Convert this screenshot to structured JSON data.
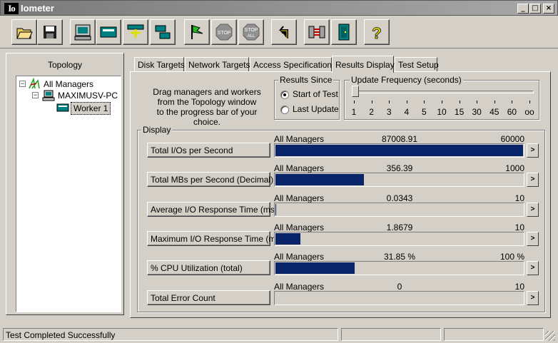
{
  "window": {
    "logo": "Io",
    "title": "Iometer"
  },
  "titlebar_buttons": {
    "minimize": "_",
    "maximize": "□",
    "close": "×"
  },
  "toolbar": {
    "buttons": [
      {
        "name": "open-config-button",
        "icon": "open-folder-icon"
      },
      {
        "name": "save-config-button",
        "icon": "save-disk-icon"
      },
      {
        "name": "start-display-button",
        "icon": "monitor-icon"
      },
      {
        "name": "start-manager-button",
        "icon": "manager-icon"
      },
      {
        "name": "new-worker-button",
        "icon": "worker-icon"
      },
      {
        "name": "network-worker-button",
        "icon": "network-icon"
      },
      {
        "name": "start-tests-button",
        "icon": "green-flag-icon"
      },
      {
        "name": "stop-button",
        "icon": "stop-sign-icon",
        "label": "STOP"
      },
      {
        "name": "stop-all-button",
        "icon": "stop-all-sign-icon",
        "label": "STOP",
        "sublabel": "ALL"
      },
      {
        "name": "reset-workers-button",
        "icon": "reset-arrow-icon"
      },
      {
        "name": "disconnect-button",
        "icon": "disconnect-icon"
      },
      {
        "name": "exit-button",
        "icon": "exit-door-icon"
      },
      {
        "name": "about-button",
        "icon": "question-mark-icon",
        "label": "?"
      }
    ]
  },
  "topology": {
    "title": "Topology",
    "nodes": [
      {
        "label": "All Managers",
        "expander": "−",
        "icon": "managers-icon"
      },
      {
        "label": "MAXIMUSV-PC",
        "expander": "−",
        "icon": "computer-icon"
      },
      {
        "label": "Worker 1",
        "icon": "disk-worker-icon",
        "selected": true
      }
    ]
  },
  "tabs": [
    {
      "label": "Disk Targets"
    },
    {
      "label": "Network Targets"
    },
    {
      "label": "Access Specifications"
    },
    {
      "label": "Results Display",
      "active": true
    },
    {
      "label": "Test Setup"
    }
  ],
  "results": {
    "instructions": [
      "Drag managers and workers",
      "from the Topology window",
      "to the progress bar of your choice."
    ],
    "since": {
      "title": "Results Since",
      "options": [
        {
          "label": "Start of Test",
          "selected": true
        },
        {
          "label": "Last Update",
          "selected": false
        }
      ]
    },
    "update_frequency": {
      "title": "Update Frequency (seconds)",
      "ticks": [
        "1",
        "2",
        "3",
        "4",
        "5",
        "10",
        "15",
        "30",
        "45",
        "60",
        "oo"
      ]
    },
    "display": {
      "title": "Display",
      "arrow": ">",
      "metrics": [
        {
          "label": "Total I/Os per Second",
          "manager": "All Managers",
          "value": "87008.91",
          "max": "60000",
          "fill": 1.0
        },
        {
          "label": "Total MBs per Second (Decimal)",
          "manager": "All Managers",
          "value": "356.39",
          "max": "1000",
          "fill": 0.356
        },
        {
          "label": "Average I/O Response Time (ms)",
          "manager": "All Managers",
          "value": "0.0343",
          "max": "10",
          "fill": 0.0034
        },
        {
          "label": "Maximum I/O Response Time (ms)",
          "manager": "All Managers",
          "value": "1.8679",
          "max": "10",
          "fill": 0.1
        },
        {
          "label": "% CPU Utilization (total)",
          "manager": "All Managers",
          "value": "31.85 %",
          "max": "100 %",
          "fill": 0.3185
        },
        {
          "label": "Total Error Count",
          "manager": "All Managers",
          "value": "0",
          "max": "10",
          "fill": 0.0
        }
      ]
    }
  },
  "status": {
    "text": "Test Completed Successfully"
  },
  "colors": {
    "bar": "#0a246a",
    "face": "#d4d0c8"
  }
}
